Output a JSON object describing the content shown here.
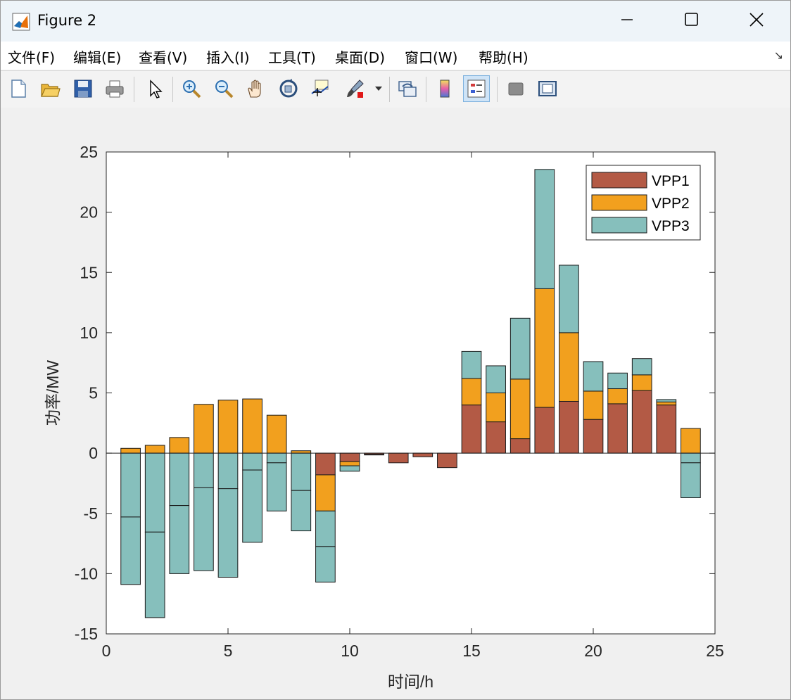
{
  "window": {
    "title": "Figure 2",
    "controls": {
      "minimize_icon": "minimize-icon",
      "maximize_icon": "maximize-icon",
      "close_icon": "close-icon"
    }
  },
  "menu": {
    "items": [
      "文件(F)",
      "编辑(E)",
      "查看(V)",
      "插入(I)",
      "工具(T)",
      "桌面(D)",
      "窗口(W)",
      "帮助(H)"
    ],
    "corner_icon": "dock-arrow-icon"
  },
  "toolbar": {
    "icons": [
      "new-figure-icon",
      "open-file-icon",
      "save-icon",
      "print-icon",
      "select-arrow-icon",
      "zoom-in-icon",
      "zoom-out-icon",
      "pan-hand-icon",
      "rotate-3d-icon",
      "data-cursor-icon",
      "brush-icon",
      "brush-dropdown-icon",
      "link-plot-icon",
      "colorbar-icon",
      "legend-icon",
      "hide-plot-tools-icon",
      "show-plot-tools-icon"
    ],
    "active": "legend-icon"
  },
  "chart_data": {
    "type": "bar",
    "stacked": true,
    "title": "",
    "xlabel": "时间/h",
    "ylabel": "功率/MW",
    "x": [
      1,
      2,
      3,
      4,
      5,
      6,
      7,
      8,
      9,
      10,
      11,
      12,
      13,
      14,
      15,
      16,
      17,
      18,
      19,
      20,
      21,
      22,
      23,
      24
    ],
    "xlim": [
      0,
      25
    ],
    "ylim": [
      -15,
      25
    ],
    "xticks": [
      0,
      5,
      10,
      15,
      20,
      25
    ],
    "yticks": [
      -15,
      -10,
      -5,
      0,
      5,
      10,
      15,
      20,
      25
    ],
    "grid": false,
    "legend": {
      "position": "top-right"
    },
    "series": [
      {
        "name": "VPP1",
        "color": "#b35a45",
        "values": [
          0,
          0,
          0,
          0,
          0,
          0,
          0,
          0,
          -1.8,
          -0.7,
          -0.1,
          -0.8,
          -0.3,
          -1.2,
          4.0,
          2.6,
          1.2,
          3.8,
          4.3,
          2.8,
          4.1,
          5.2,
          4.0,
          0
        ]
      },
      {
        "name": "VPP2",
        "color": "#f2a01e",
        "values": [
          0.4,
          0.65,
          1.3,
          4.05,
          4.4,
          4.5,
          3.15,
          0.2,
          -3.0,
          -0.35,
          0,
          0,
          0,
          0,
          2.2,
          2.4,
          4.95,
          9.85,
          5.7,
          2.35,
          1.25,
          1.3,
          0.25,
          2.05
        ]
      },
      {
        "name": "VPP3",
        "color": "#86bfbc",
        "values": [
          -5.3,
          -6.55,
          -4.35,
          -2.85,
          -2.95,
          -1.4,
          -0.8,
          -3.1,
          -2.95,
          -0.45,
          -0.05,
          0,
          0,
          0,
          2.25,
          2.25,
          5.05,
          9.9,
          5.6,
          2.45,
          1.3,
          1.35,
          0.2,
          -0.8
        ]
      },
      {
        "name": "",
        "color": "#86bfbc",
        "values": [
          -5.6,
          -7.1,
          -5.65,
          -6.9,
          -7.35,
          -6.0,
          -4.0,
          -3.35,
          -2.95,
          0,
          0,
          0,
          0,
          0,
          0,
          0,
          0,
          0,
          0,
          0,
          0,
          0,
          0,
          -2.9
        ]
      }
    ]
  }
}
